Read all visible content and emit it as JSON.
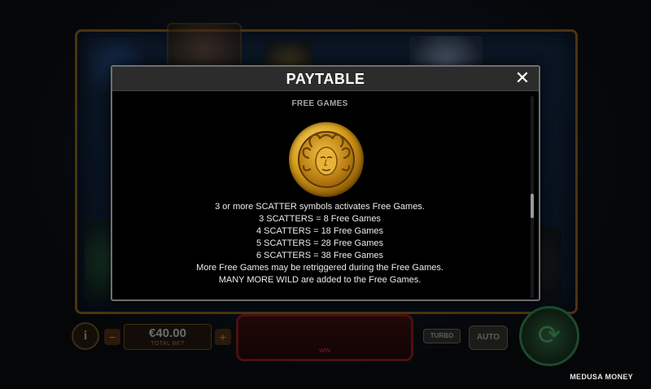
{
  "modal": {
    "title": "PAYTABLE",
    "close_icon": "close-icon",
    "section_title": "FREE GAMES",
    "symbol_icon": "medusa-scatter-icon",
    "lines": [
      "3 or more SCATTER symbols activates Free Games.",
      "3 SCATTERS = 8 Free Games",
      "4 SCATTERS = 18 Free Games",
      "5 SCATTERS = 28 Free Games",
      "6 SCATTERS = 38 Free Games",
      "More Free Games may be retriggered during the Free Games.",
      "MANY MORE WILD are added to the Free Games."
    ]
  },
  "controls": {
    "info_label": "i",
    "bet_value": "€40.00",
    "bet_label": "TOTAL BET",
    "minus_label": "−",
    "plus_label": "+",
    "win_label": "WIN",
    "turbo_label": "TURBO",
    "auto_label": "AUTO",
    "spin_icon": "spin-arrows-icon"
  },
  "footer": {
    "game_name": "MEDUSA MONEY"
  },
  "colors": {
    "modal_bg": "#000000",
    "header_bg": "#2c2c2c",
    "gold": "#d49a17"
  }
}
